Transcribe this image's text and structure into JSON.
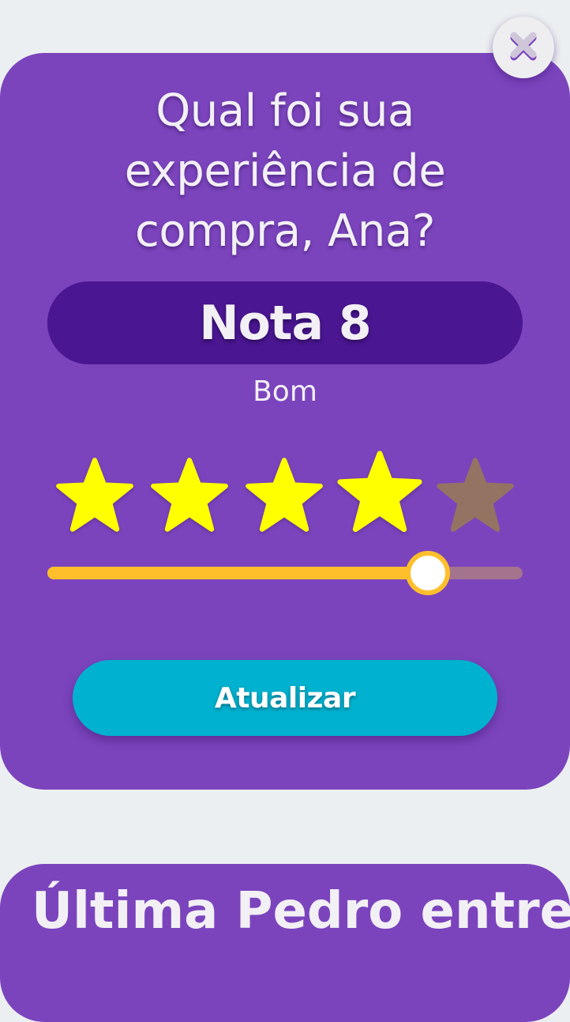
{
  "survey": {
    "question": "Qual foi sua experiência de compra, Ana?",
    "score_text": "Nota 8",
    "score_label": "Bom",
    "rating": {
      "value": 4,
      "max": 5,
      "filled_color": "#ffff00",
      "empty_color": "#947363"
    },
    "slider": {
      "value": 8,
      "max": 10,
      "fill_color": "#ffbf2b",
      "track_color": "#a4738e"
    },
    "update_button_label": "Atualizar"
  },
  "colors": {
    "card_background": "#7b44bd",
    "score_pill_background": "#4a1691",
    "button_background": "#00b2cf",
    "page_background": "#eceff1"
  },
  "close_button": {
    "icon": "close-icon"
  },
  "next_card": {
    "title": "Última Pedro entre"
  }
}
